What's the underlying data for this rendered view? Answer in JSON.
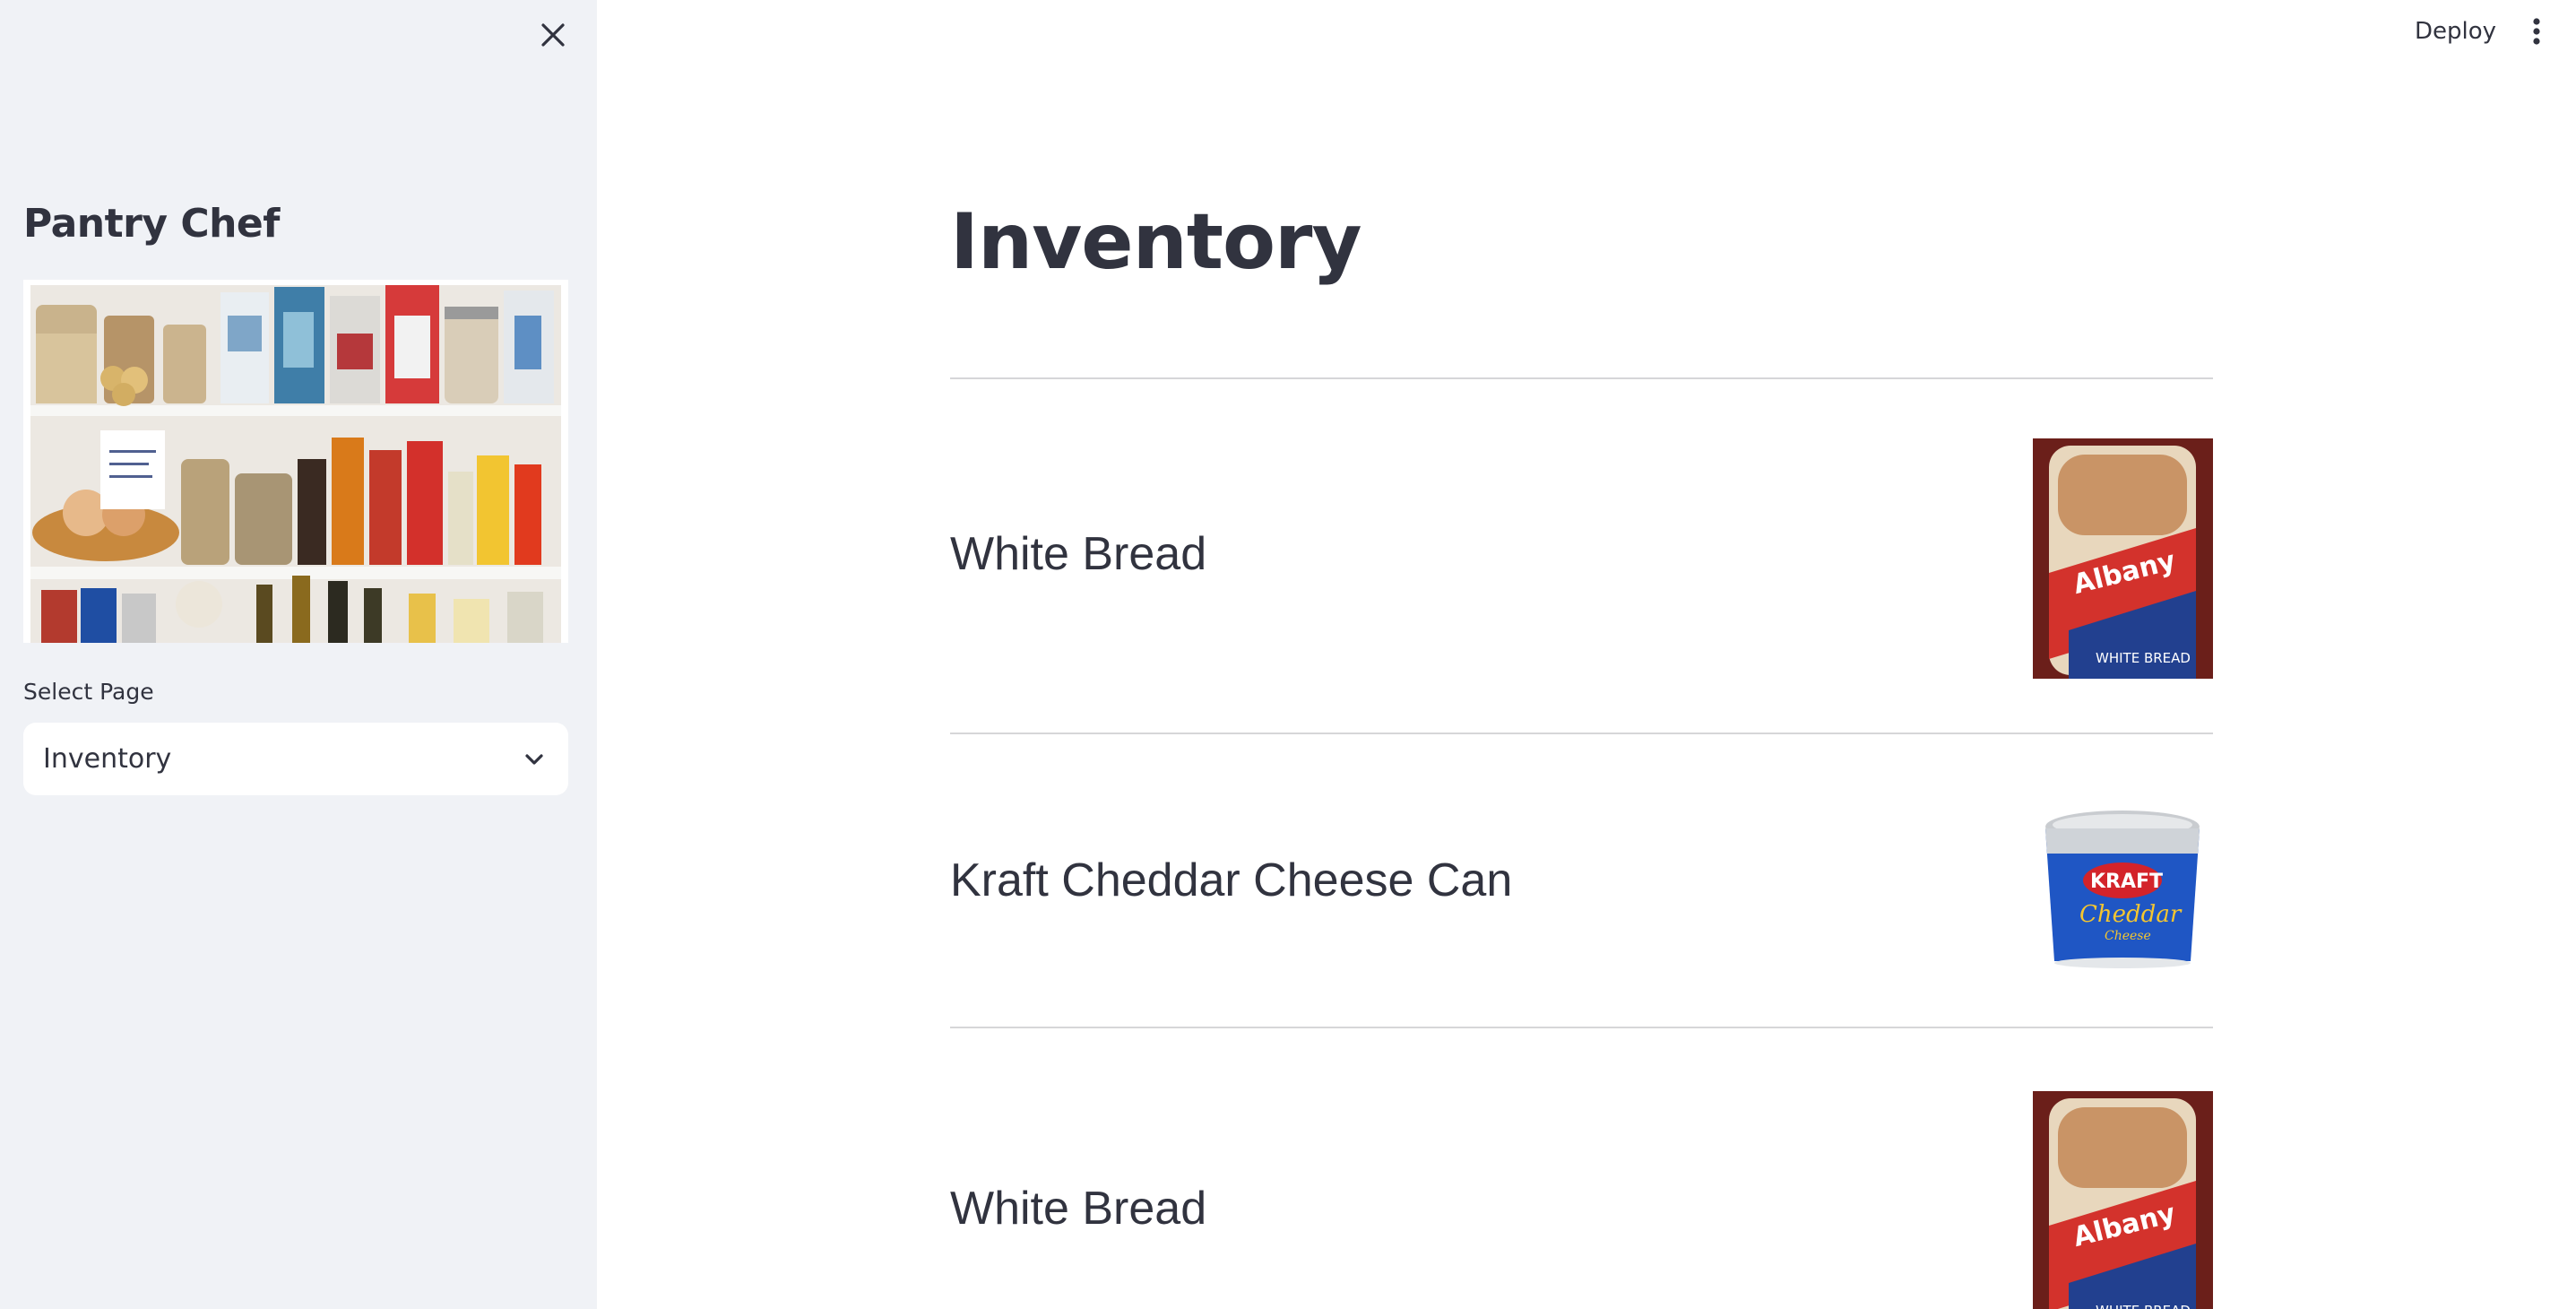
{
  "sidebar": {
    "title": "Pantry Chef",
    "select_label": "Select Page",
    "selected_page": "Inventory"
  },
  "header": {
    "deploy_label": "Deploy"
  },
  "main": {
    "title": "Inventory",
    "items": [
      {
        "name": "White Bread"
      },
      {
        "name": "Kraft Cheddar Cheese Can"
      },
      {
        "name": "White Bread"
      }
    ]
  },
  "colors": {
    "sidebar_bg": "#f0f2f6",
    "text": "#31333f",
    "divider": "#d6d6d8"
  }
}
